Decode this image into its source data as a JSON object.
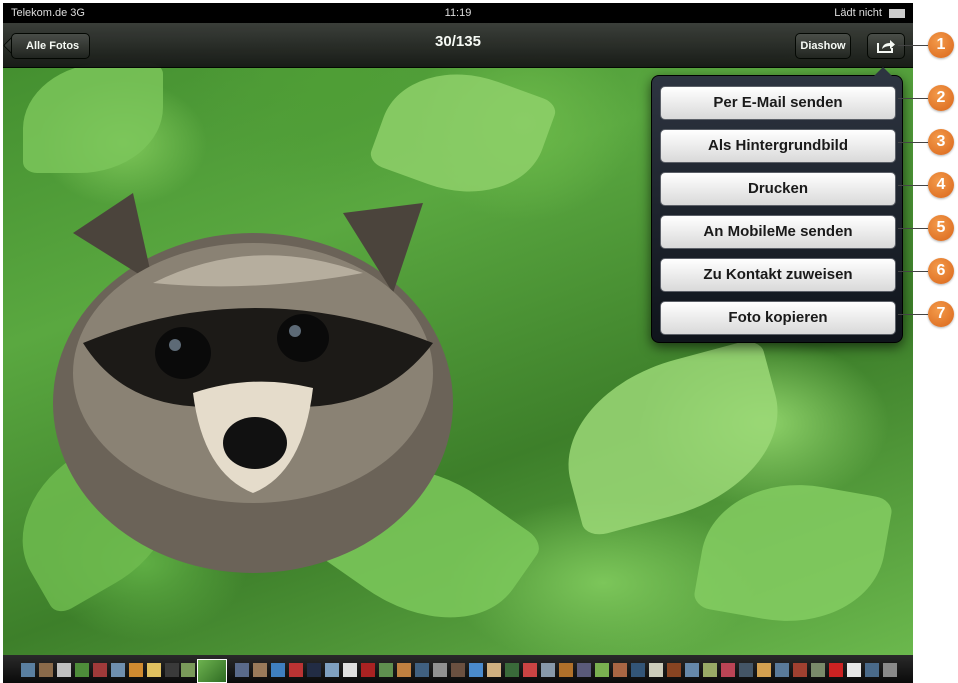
{
  "status_bar": {
    "carrier": "Telekom.de 3G",
    "time": "11:19",
    "battery_label": "Lädt nicht"
  },
  "nav_bar": {
    "back_label": "Alle Fotos",
    "title": "30/135",
    "slideshow_label": "Diashow",
    "share_icon": "share-icon"
  },
  "share_menu": {
    "items": [
      {
        "label": "Per E-Mail senden"
      },
      {
        "label": "Als Hintergrundbild"
      },
      {
        "label": "Drucken"
      },
      {
        "label": "An MobileMe senden"
      },
      {
        "label": "Zu Kontakt zuweisen"
      },
      {
        "label": "Foto kopieren"
      }
    ]
  },
  "callouts": [
    "1",
    "2",
    "3",
    "4",
    "5",
    "6",
    "7"
  ],
  "colors": {
    "callout": "#e47a2e",
    "bar": "#1e1e1e",
    "menu_button": "#f2f2f2"
  }
}
